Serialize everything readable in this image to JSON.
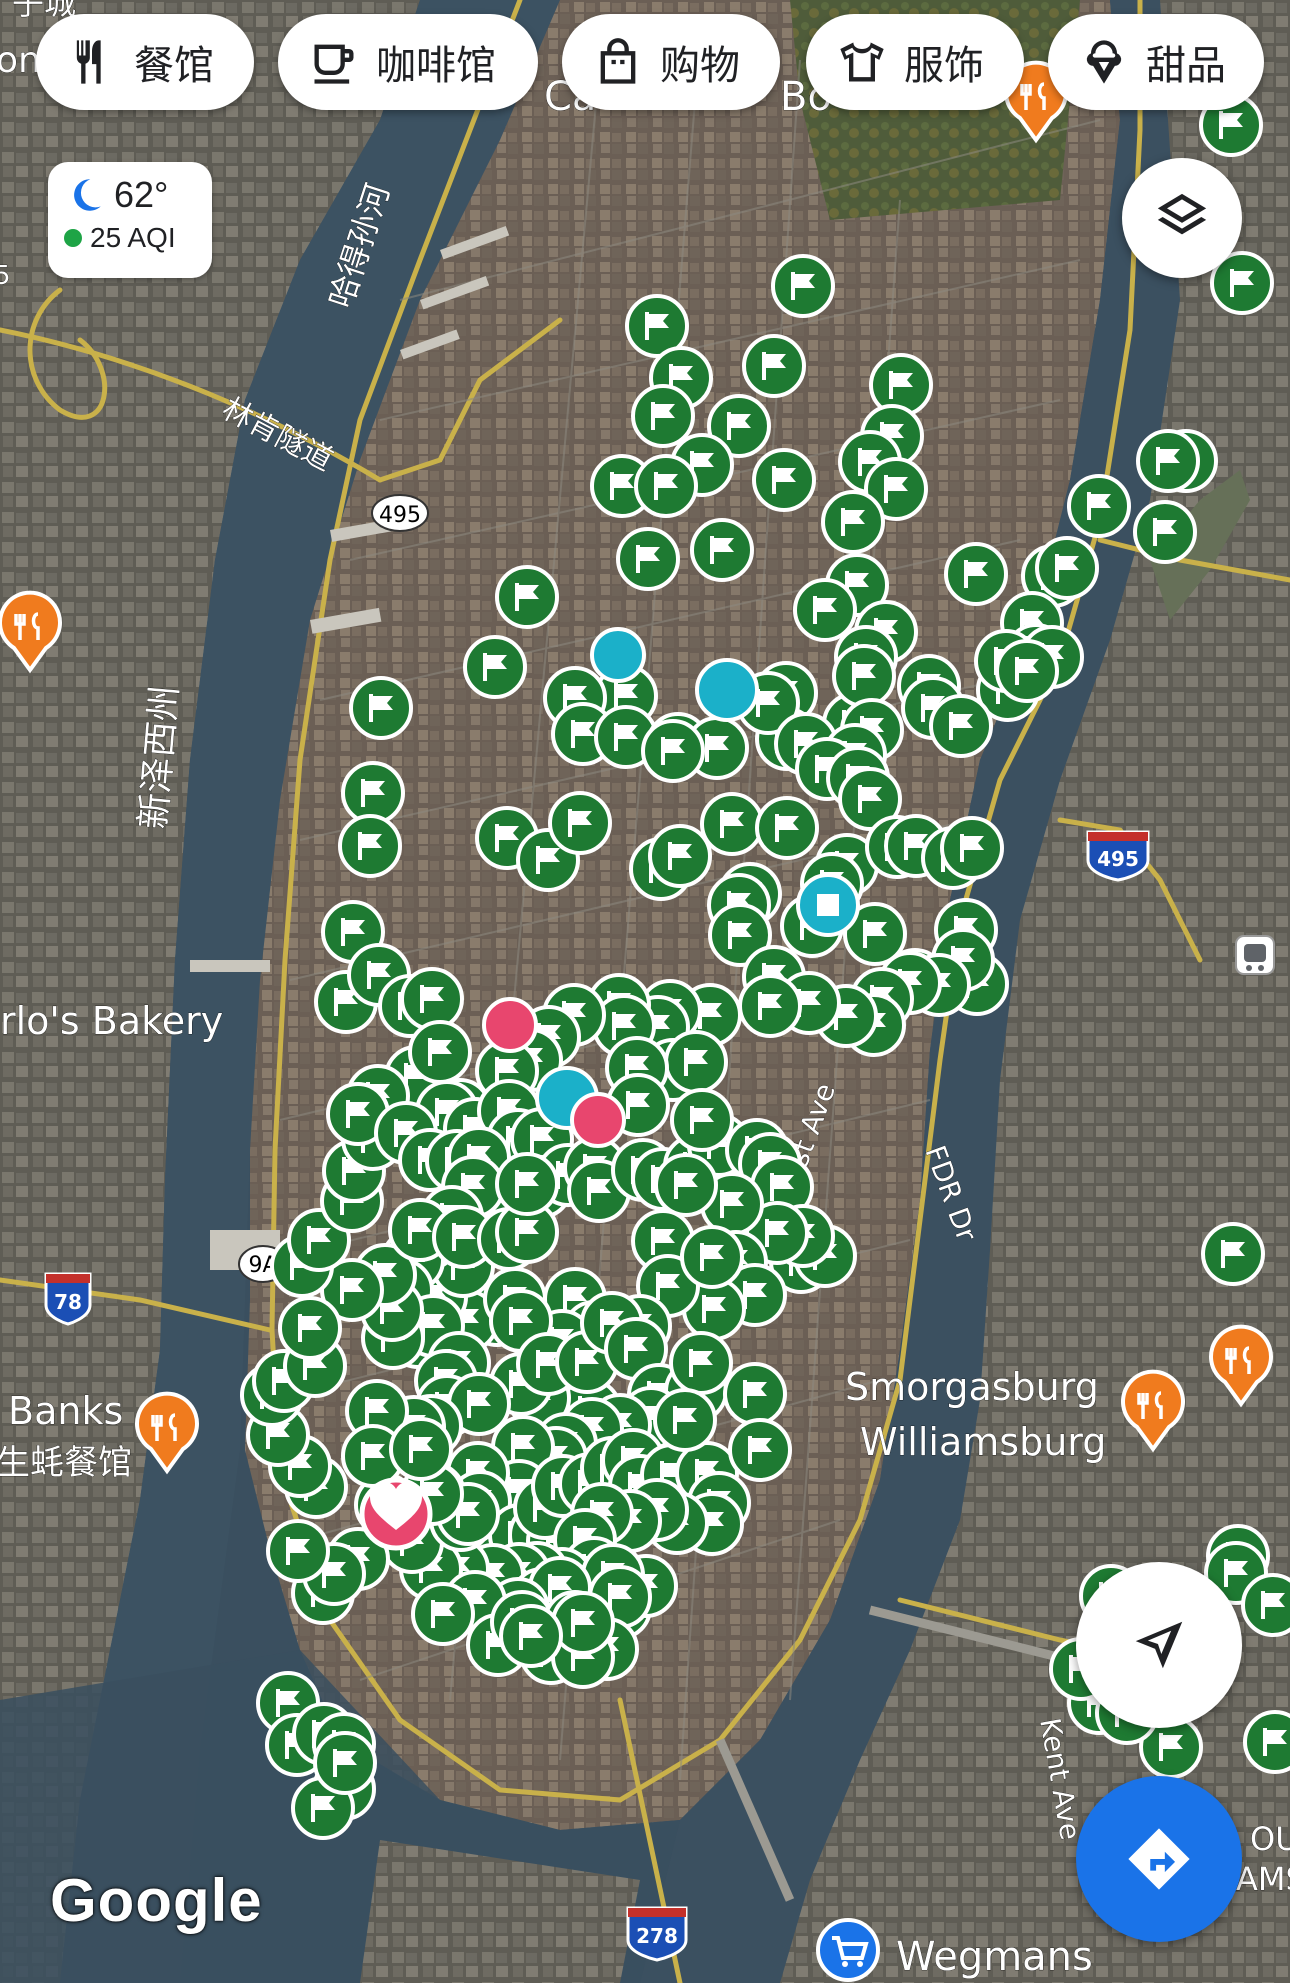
{
  "chips": [
    {
      "label": "餐馆",
      "icon": "restaurant-icon"
    },
    {
      "label": "咖啡馆",
      "icon": "coffee-icon"
    },
    {
      "label": "购物",
      "icon": "shopping-bag-icon"
    },
    {
      "label": "服饰",
      "icon": "shirt-icon"
    },
    {
      "label": "甜品",
      "icon": "ice-cream-icon"
    }
  ],
  "weather": {
    "temperature": "62°",
    "aqi": "25 AQI",
    "icon": "moon-icon",
    "aqi_color": "#1ea446"
  },
  "map_labels": {
    "hudson_river": "哈得孙河",
    "lincoln_tunnel": "林肯隧道",
    "new_jersey": "新泽西州",
    "carlos_bakery": "rlo's Bakery",
    "banks": "Banks",
    "oyster_restaurant": "生蚝餐馆",
    "first_ave": "1st Ave",
    "fdr_dr": "FDR Dr",
    "smorgasburg": "Smorgasburg\nWilliamsburg",
    "kent_ave": "Kent Ave",
    "wegmans": "Wegmans",
    "top_left_partial": "子城",
    "central_park_partial": "Ca",
    "bo_partial": "Bo",
    "out_partial": "OUT",
    "ams_partial": "AMS",
    "one_partial": "on",
    "five_partial": "5"
  },
  "route_shields": [
    {
      "text": "495",
      "type": "state"
    },
    {
      "text": "495",
      "type": "interstate"
    },
    {
      "text": "9A",
      "type": "state"
    },
    {
      "text": "78",
      "type": "interstate"
    },
    {
      "text": "278",
      "type": "interstate"
    }
  ],
  "watermark": "© 2024 Google",
  "attribution": "Google",
  "colors": {
    "flag_pin": "#1e7a32",
    "restaurant_pin": "#f07b1e",
    "teal_pin": "#1bb0c9",
    "heart_pin": "#e8466e",
    "water": "#3a4f5f",
    "direction_button": "#1a73e8"
  },
  "buttons": {
    "layers": "layers-icon",
    "my_location": "navigation-arrow-icon",
    "directions": "directions-icon"
  }
}
